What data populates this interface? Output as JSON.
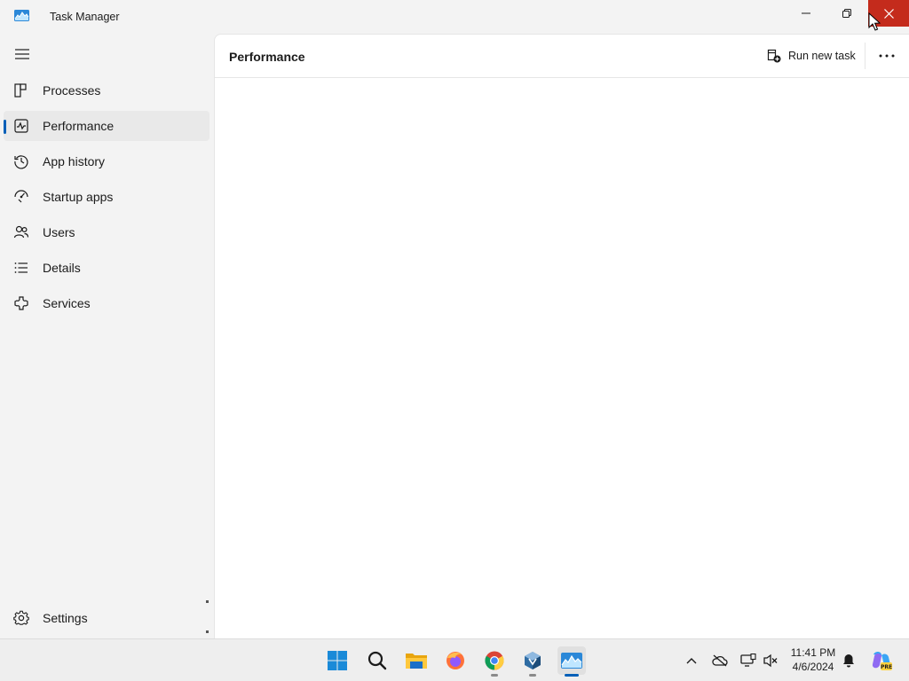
{
  "window": {
    "title": "Task Manager",
    "icon": "task-manager-icon",
    "controls": {
      "minimize": "minimize-icon",
      "maximize": "restore-icon",
      "close": "close-icon"
    }
  },
  "sidebar": {
    "menu_icon": "hamburger-icon",
    "items": [
      {
        "label": "Processes",
        "icon": "processes-icon",
        "selected": false
      },
      {
        "label": "Performance",
        "icon": "performance-icon",
        "selected": true
      },
      {
        "label": "App history",
        "icon": "history-icon",
        "selected": false
      },
      {
        "label": "Startup apps",
        "icon": "startup-icon",
        "selected": false
      },
      {
        "label": "Users",
        "icon": "users-icon",
        "selected": false
      },
      {
        "label": "Details",
        "icon": "details-icon",
        "selected": false
      },
      {
        "label": "Services",
        "icon": "services-icon",
        "selected": false
      }
    ],
    "settings": {
      "label": "Settings",
      "icon": "settings-icon"
    }
  },
  "header": {
    "title": "Performance",
    "run_new_task": "Run new task",
    "more_icon": "more-icon"
  },
  "taskbar": {
    "apps": [
      {
        "name": "start",
        "icon": "windows-start-icon",
        "running": false
      },
      {
        "name": "search",
        "icon": "search-icon",
        "running": false
      },
      {
        "name": "file-explorer",
        "icon": "folder-icon",
        "running": false
      },
      {
        "name": "firefox",
        "icon": "firefox-icon",
        "running": false
      },
      {
        "name": "chrome",
        "icon": "chrome-icon",
        "running": true
      },
      {
        "name": "virtualbox",
        "icon": "virtualbox-icon",
        "running": true
      },
      {
        "name": "task-manager",
        "icon": "task-manager-icon",
        "running": true,
        "active": true
      }
    ],
    "tray": [
      "chevron-up-icon",
      "onedrive-offline-icon",
      "network-icon",
      "volume-muted-icon"
    ],
    "clock": {
      "time": "11:41 PM",
      "date": "4/6/2024"
    },
    "notification_icon": "bell-icon",
    "copilot": {
      "icon": "copilot-icon",
      "badge": "PRE"
    }
  },
  "colors": {
    "accent": "#005fb8",
    "close_hover": "#c42b1c",
    "sidebar_bg": "#f3f3f3",
    "content_bg": "#ffffff",
    "selected_bg": "#e9e9e9"
  }
}
